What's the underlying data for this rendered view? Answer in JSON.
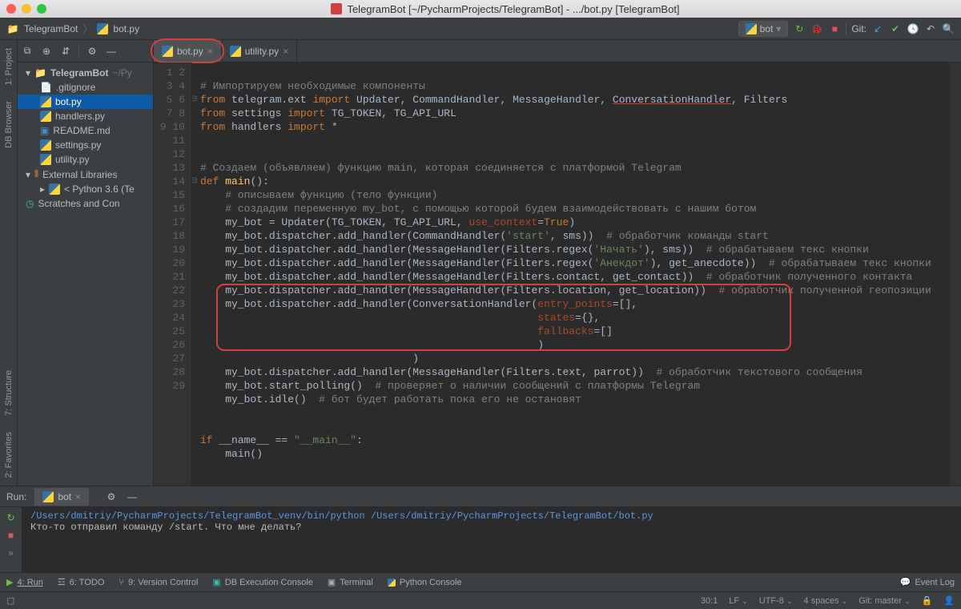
{
  "window": {
    "title": "TelegramBot [~/PycharmProjects/TelegramBot] - .../bot.py [TelegramBot]"
  },
  "breadcrumb": {
    "project": "TelegramBot",
    "file": "bot.py"
  },
  "run_config": {
    "label": "bot"
  },
  "toolbar": {
    "git_label": "Git:"
  },
  "sidebar": {
    "project": "TelegramBot",
    "project_path": "~/Py",
    "files": [
      ".gitignore",
      "bot.py",
      "handlers.py",
      "README.md",
      "settings.py",
      "utility.py"
    ],
    "ext_lib": "External Libraries",
    "python": "< Python 3.6 (Te",
    "scratches": "Scratches and Con"
  },
  "left_tabs": {
    "project": "1: Project",
    "db": "DB Browser",
    "structure": "7: Structure",
    "favorites": "2: Favorites"
  },
  "editor_tabs": [
    {
      "name": "bot.py",
      "active": true,
      "circled": true
    },
    {
      "name": "utility.py",
      "active": false,
      "circled": false
    }
  ],
  "code": {
    "lines": 29,
    "l1": "# Импортируем необходимые компоненты",
    "l2_1": "from",
    "l2_2": " telegram.ext ",
    "l2_3": "import",
    "l2_4": " Updater, CommandHandler, MessageHandler, ",
    "l2_5": "ConversationHandler",
    "l2_6": ", Filters",
    "l3_1": "from",
    "l3_2": " settings ",
    "l3_3": "import",
    "l3_4": " TG_TOKEN, TG_API_URL",
    "l4_1": "from",
    "l4_2": " handlers ",
    "l4_3": "import",
    "l4_4": " *",
    "l7": "# Создаем (объявляем) функцию main, которая соединяется с платформой Telegram",
    "l8_1": "def ",
    "l8_2": "main",
    "l8_3": "():",
    "l9": "    # описываем функцию (тело функции)",
    "l10": "    # создадим переменную my_bot, с помощью которой будем взаимодействовать с нашим ботом",
    "l11_1": "    my_bot = Updater(TG_TOKEN, TG_API_URL, ",
    "l11_2": "use_context",
    "l11_3": "=",
    "l11_4": "True",
    "l11_5": ")",
    "l12_1": "    my_bot.dispatcher.add_handler(CommandHandler(",
    "l12_2": "'start'",
    "l12_3": ", sms))  ",
    "l12_4": "# обработчик команды start",
    "l13_1": "    my_bot.dispatcher.add_handler(MessageHandler(Filters.regex(",
    "l13_2": "'Начать'",
    "l13_3": "), sms))  ",
    "l13_4": "# обрабатываем текс кнопки",
    "l14_1": "    my_bot.dispatcher.add_handler(MessageHandler(Filters.regex(",
    "l14_2": "'Анекдот'",
    "l14_3": "), get_anecdote))  ",
    "l14_4": "# обрабатываем текс кнопки",
    "l15_1": "    my_bot.dispatcher.add_handler(MessageHandler(Filters.contact, get_contact))  ",
    "l15_2": "# обработчик полученного контакта",
    "l16_1": "    my_bot.dispatcher.add_handler(MessageHandler(Filters.location, get_location))  ",
    "l16_2": "# обработчик полученной геопозиции",
    "l17_1": "    my_bot.dispatcher.add_handler(ConversationHandler(",
    "l17_2": "entry_points",
    "l17_3": "=[],",
    "l18_1": "                                                      ",
    "l18_2": "states",
    "l18_3": "={},",
    "l19_1": "                                                      ",
    "l19_2": "fallbacks",
    "l19_3": "=[]",
    "l20": "                                                      )",
    "l21": "                                  )",
    "l22_1": "    my_bot.dispatcher.add_handler(MessageHandler(Filters.text, parrot))  ",
    "l22_2": "# обработчик текстового сообщения",
    "l23_1": "    my_bot.start_polling()  ",
    "l23_2": "# проверяет о наличии сообщений с платформы Telegram",
    "l24_1": "    my_bot.idle()  ",
    "l24_2": "# бот будет работать пока его не остановят",
    "l27_1": "if",
    "l27_2": " __name__ == ",
    "l27_3": "\"__main__\"",
    "l27_4": ":",
    "l28": "    main()"
  },
  "run": {
    "label": "Run:",
    "tab": "bot",
    "cmd": "/Users/dmitriy/PycharmProjects/TelegramBot_venv/bin/python /Users/dmitriy/PycharmProjects/TelegramBot/bot.py",
    "out": "Кто-то отправил команду /start. Что мне делать?"
  },
  "bottom": {
    "run": "4: Run",
    "todo": "6: TODO",
    "vcs": "9: Version Control",
    "db": "DB Execution Console",
    "terminal": "Terminal",
    "pycon": "Python Console",
    "eventlog": "Event Log"
  },
  "status": {
    "pos": "30:1",
    "le": "LF",
    "enc": "UTF-8",
    "indent": "4 spaces",
    "git": "Git: master",
    "lock": "🔒"
  }
}
